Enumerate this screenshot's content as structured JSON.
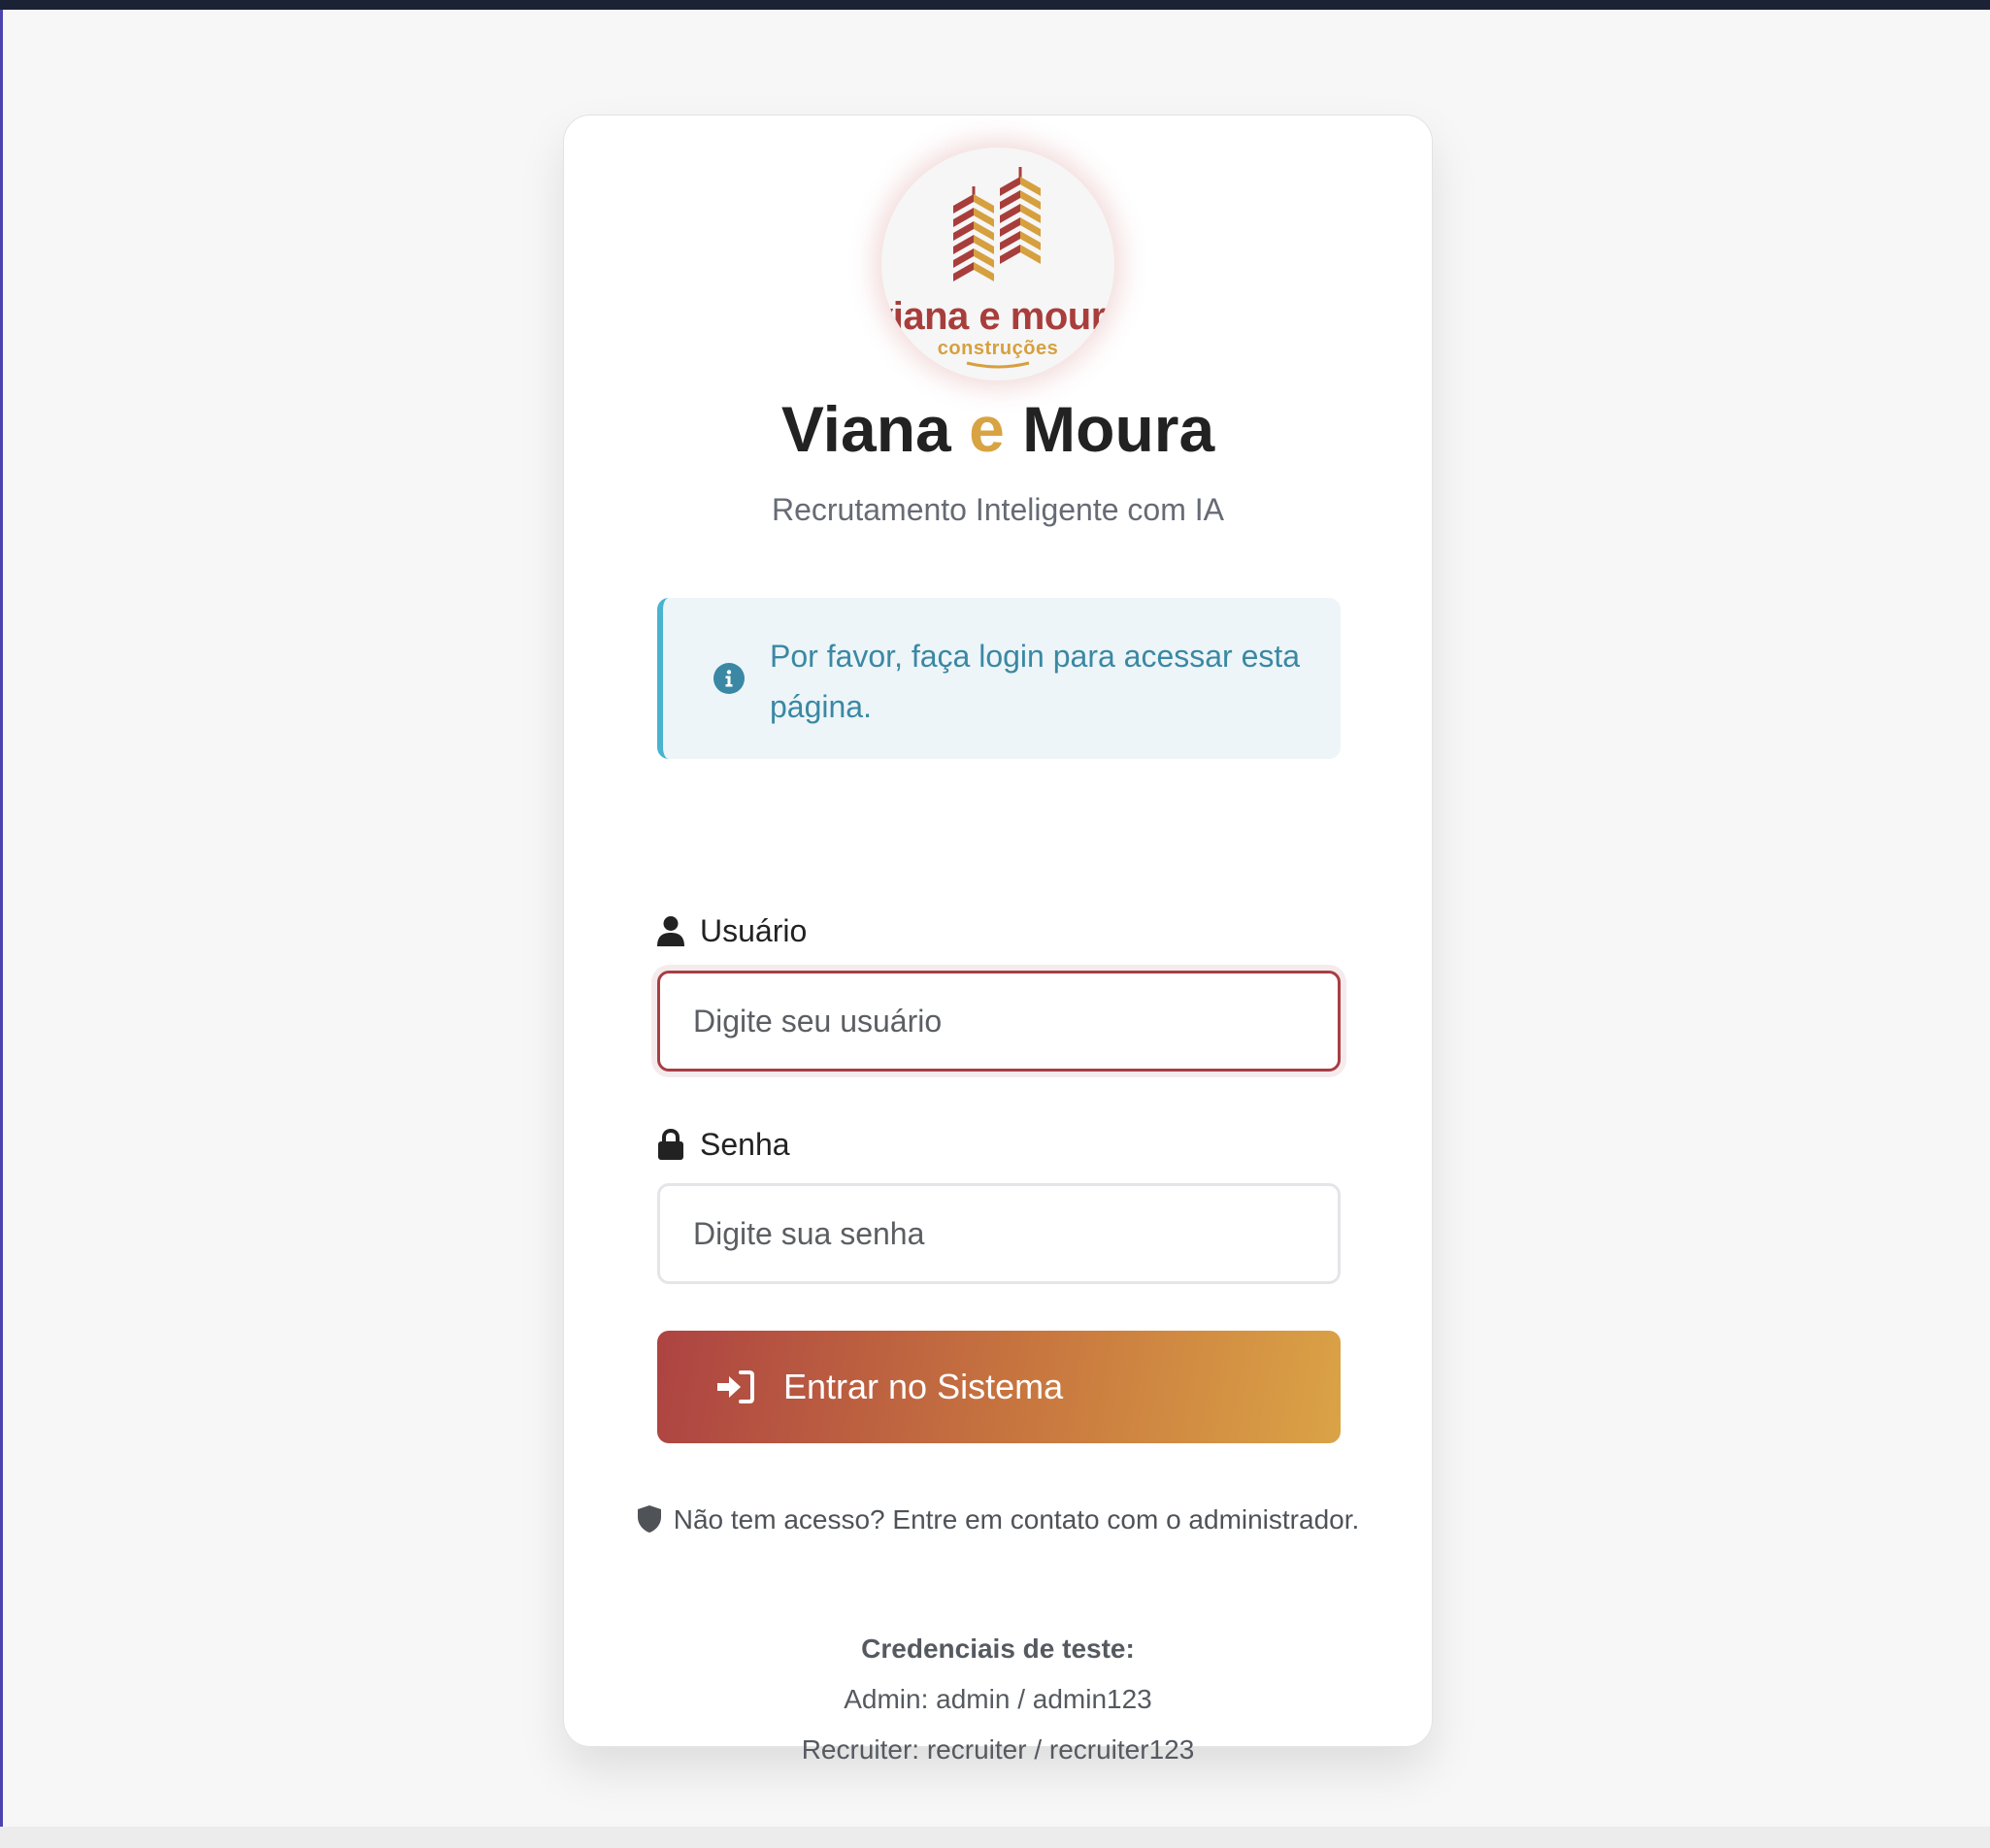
{
  "logo": {
    "wordmark": "viana e moura",
    "tagline": "construções",
    "icon": "building-logo-icon"
  },
  "brand": {
    "title_part1": "Viana",
    "title_connector": "e",
    "title_part2": "Moura",
    "subtitle": "Recrutamento Inteligente com IA"
  },
  "alert": {
    "icon": "info-circle-icon",
    "message": "Por favor, faça login para acessar esta página."
  },
  "form": {
    "username": {
      "icon": "user-icon",
      "label": "Usuário",
      "placeholder": "Digite seu usuário",
      "value": ""
    },
    "password": {
      "icon": "lock-icon",
      "label": "Senha",
      "placeholder": "Digite sua senha",
      "value": ""
    },
    "submit": {
      "icon": "sign-in-icon",
      "label": "Entrar no Sistema"
    }
  },
  "help": {
    "icon": "shield-icon",
    "text": "Não tem acesso? Entre em contato com o administrador."
  },
  "credentials": {
    "title": "Credenciais de teste:",
    "admin": "Admin: admin / admin123",
    "recruiter": "Recruiter: recruiter / recruiter123"
  },
  "colors": {
    "accent_red": "#a83e44",
    "accent_gold": "#d8a343",
    "alert_bg": "#edf5f8",
    "alert_border": "#4ab3cf",
    "alert_text": "#3a88a4",
    "top_bar": "#1c2235"
  }
}
